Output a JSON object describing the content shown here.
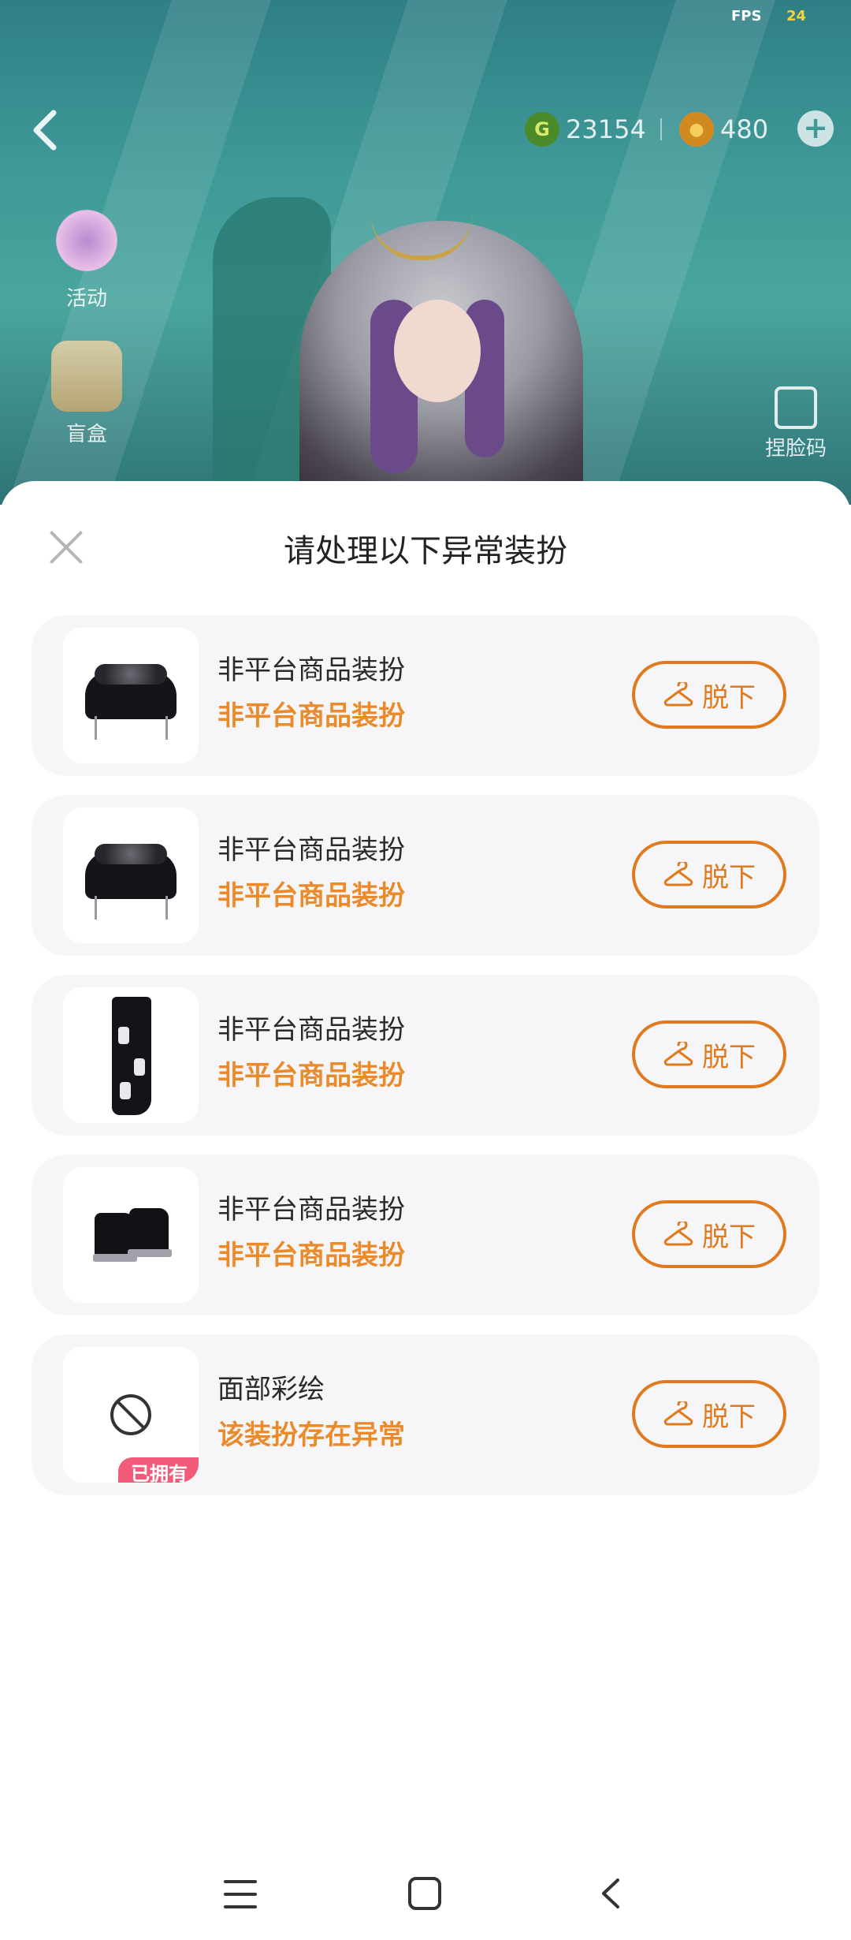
{
  "status": {
    "fps_label": "FPS",
    "fps_value": "24"
  },
  "top_bar": {
    "currency_green": {
      "icon": "g-coin-icon",
      "amount": "23154",
      "glyph": "G"
    },
    "currency_gold": {
      "icon": "gold-coin-icon",
      "amount": "480",
      "glyph": "●"
    },
    "plus": "+"
  },
  "side_menu": {
    "activity_label": "活动",
    "blindbox_label": "盲盒"
  },
  "face_code_label": "捏脸码",
  "modal": {
    "title": "请处理以下异常装扮",
    "items": [
      {
        "name": "非平台商品装扮",
        "status": "非平台商品装扮",
        "action": "脱下",
        "thumb": "jacket"
      },
      {
        "name": "非平台商品装扮",
        "status": "非平台商品装扮",
        "action": "脱下",
        "thumb": "jacket"
      },
      {
        "name": "非平台商品装扮",
        "status": "非平台商品装扮",
        "action": "脱下",
        "thumb": "skirt"
      },
      {
        "name": "非平台商品装扮",
        "status": "非平台商品装扮",
        "action": "脱下",
        "thumb": "boots"
      },
      {
        "name": "面部彩绘",
        "status": "该装扮存在异常",
        "action": "脱下",
        "thumb": "ban-icon",
        "badge": "已拥有"
      }
    ]
  },
  "colors": {
    "accent": "#e07a1e",
    "status_text": "#ea8a2a",
    "badge": "#f25b7a"
  }
}
